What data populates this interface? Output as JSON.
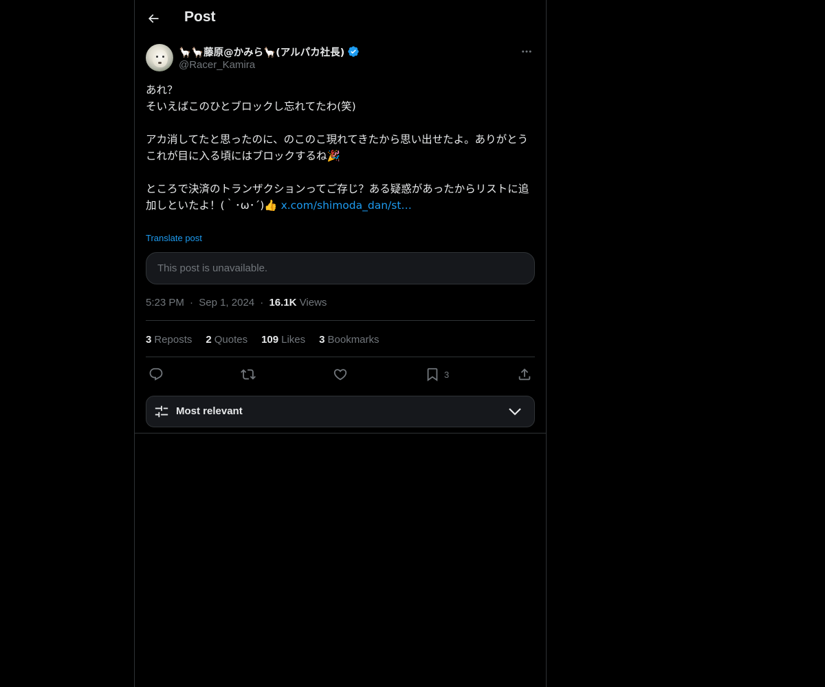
{
  "header": {
    "title": "Post"
  },
  "post": {
    "author": {
      "display_name": "🦙🦙藤原@かみら🦙(アルパカ社長)",
      "handle": "@Racer_Kamira",
      "verified": true
    },
    "text_lines": [
      "あれ？",
      "そいえばこのひとブロックし忘れてたわ(笑)",
      "",
      "アカ消してたと思ったのに、のこのこ現れてきたから思い出せたよ。ありがとう",
      "これが目に入る頃にはブロックするね🎉",
      "",
      "ところで決済のトランザクションってご存じ？ある疑惑があったからリストに追加しといたよ！(｀･ω･´)👍 "
    ],
    "link_text": "x.com/shimoda_dan/st…",
    "translate_label": "Translate post",
    "quoted_unavailable": "This post is unavailable.",
    "time": "5:23 PM",
    "date": "Sep 1, 2024",
    "separator": "·",
    "views_count": "16.1K",
    "views_label": "Views"
  },
  "stats": {
    "reposts_count": "3",
    "reposts_label": "Reposts",
    "quotes_count": "2",
    "quotes_label": "Quotes",
    "likes_count": "109",
    "likes_label": "Likes",
    "bookmarks_count": "3",
    "bookmarks_label": "Bookmarks"
  },
  "actions": {
    "bookmark_count": "3"
  },
  "replies_sort": {
    "label": "Most relevant"
  },
  "colors": {
    "background": "#000000",
    "text_primary": "#e7e9ea",
    "text_secondary": "#71767b",
    "accent": "#1d9bf0",
    "border": "#2f3336",
    "card": "#16181c"
  }
}
